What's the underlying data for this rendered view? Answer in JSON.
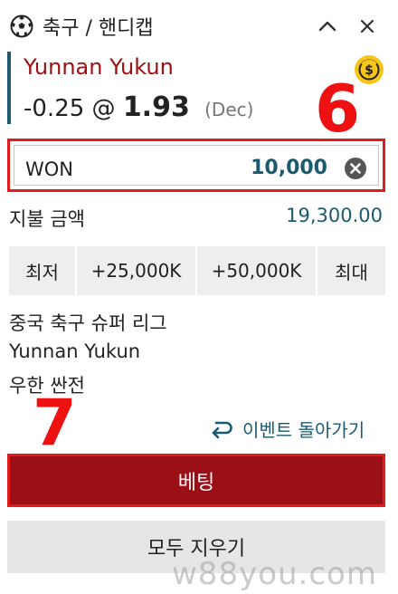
{
  "header": {
    "title": "축구 / 핸디캡"
  },
  "selection": {
    "team": "Yunnan Yukun",
    "handicap": "-0.25 @",
    "odds": "1.93",
    "odds_format": "(Dec)"
  },
  "stake": {
    "currency": "WON",
    "amount": "10,000"
  },
  "payout": {
    "label": "지불 금액",
    "value": "19,300.00"
  },
  "quick_stakes": [
    "최저",
    "+25,000K",
    "+50,000K",
    "최대"
  ],
  "match": {
    "league": "중국 축구 슈퍼 리그",
    "team": "Yunnan Yukun",
    "market": "우한 싼전"
  },
  "back_link": "이벤트 돌아가기",
  "buttons": {
    "bet": "베팅",
    "clear_all": "모두 지우기"
  },
  "annotations": {
    "six": "6",
    "seven": "7"
  },
  "watermark": "w88you.com",
  "colors": {
    "accent": "#1d5a70",
    "team_red": "#a01010",
    "highlight_red": "#e31b1b",
    "bet_button": "#9b0f16",
    "coin": "#f5c518"
  },
  "icons": {
    "sport": "soccer-ball-icon",
    "collapse": "chevron-up-icon",
    "close": "close-icon",
    "cashout": "dollar-coin-icon",
    "clear": "clear-x-icon",
    "back": "return-arrow-icon"
  }
}
